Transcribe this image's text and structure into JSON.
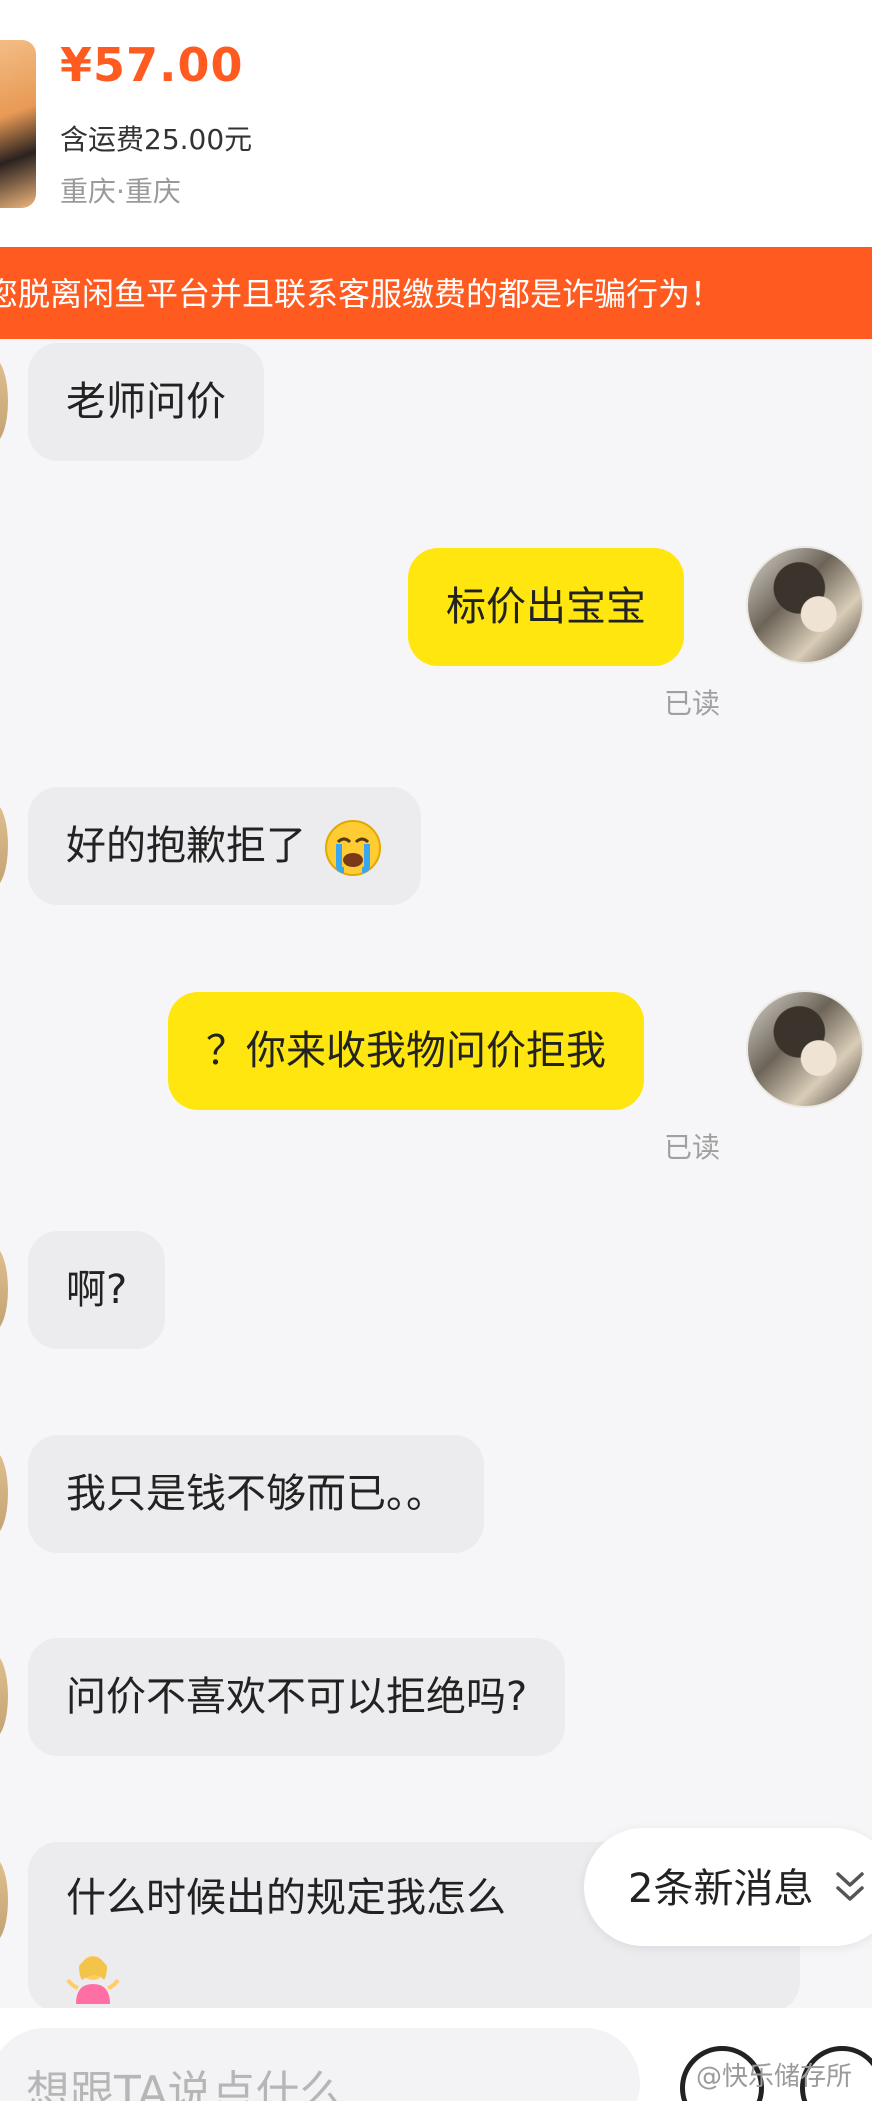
{
  "product": {
    "price": "¥57.00",
    "shipping": "含运费25.00元",
    "location": "重庆·重庆"
  },
  "warning": {
    "text": "您脱离闲鱼平台并且联系客服缴费的都是诈骗行为！"
  },
  "messages": [
    {
      "from": "other",
      "text": "老师问价"
    },
    {
      "from": "me",
      "text": "标价出宝宝",
      "status": "已读"
    },
    {
      "from": "other",
      "text": "好的抱歉拒了",
      "emoji": "crying-face"
    },
    {
      "from": "me",
      "text": "？你来收我物问价拒我",
      "status": "已读"
    },
    {
      "from": "other",
      "text": "啊?"
    },
    {
      "from": "other",
      "text": "我只是钱不够而已。。"
    },
    {
      "from": "other",
      "text": "问价不喜欢不可以拒绝吗?"
    },
    {
      "from": "other",
      "text": "什么时候出的规定我怎么",
      "emoji": "woman-shrugging"
    }
  ],
  "new_messages": {
    "label": "2条新消息",
    "icon": "double-chevron-down-icon"
  },
  "input": {
    "placeholder": "想跟TA说点什么..."
  },
  "watermark": "@快乐储存所",
  "colors": {
    "accent_orange": "#ff5a1f",
    "my_bubble": "#ffe60f",
    "their_bubble": "#ececef"
  }
}
